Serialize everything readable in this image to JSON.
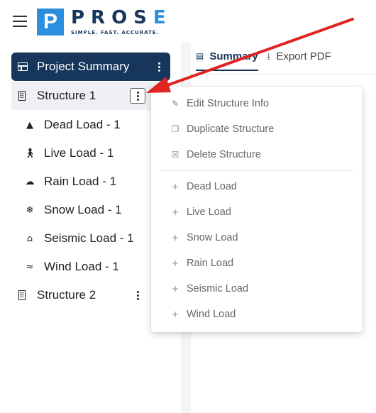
{
  "brand": {
    "logo_letter": "P",
    "name_main": "PROS",
    "name_accent": "E",
    "tagline": "SIMPLE. FAST. ACCURATE.",
    "colors": {
      "navy": "#16365c",
      "blue": "#2b8fe0",
      "arrow": "#e02424"
    }
  },
  "tabs": [
    {
      "label": "Summary",
      "icon": "document-icon",
      "active": true
    },
    {
      "label": "Export PDF",
      "icon": "download-icon",
      "active": false
    }
  ],
  "sidebar": {
    "project_summary": {
      "label": "Project Summary",
      "icon": "table-icon"
    },
    "structures": [
      {
        "label": "Structure 1",
        "icon": "building-icon",
        "selected": true,
        "loads": [
          {
            "label": "Dead Load - 1",
            "icon": "weight-icon"
          },
          {
            "label": "Live Load - 1",
            "icon": "person-walking-icon"
          },
          {
            "label": "Rain Load - 1",
            "icon": "cloud-rain-icon"
          },
          {
            "label": "Snow Load - 1",
            "icon": "snowflake-icon"
          },
          {
            "label": "Seismic Load - 1",
            "icon": "house-quake-icon"
          },
          {
            "label": "Wind Load - 1",
            "icon": "wind-icon"
          }
        ]
      },
      {
        "label": "Structure 2",
        "icon": "building-icon",
        "selected": false,
        "loads": []
      }
    ]
  },
  "context_menu": {
    "actions": [
      {
        "label": "Edit Structure Info",
        "icon": "edit-icon"
      },
      {
        "label": "Duplicate Structure",
        "icon": "copy-icon"
      },
      {
        "label": "Delete Structure",
        "icon": "trash-icon"
      }
    ],
    "add_items": [
      {
        "label": "Dead Load",
        "icon": "plus-icon"
      },
      {
        "label": "Live Load",
        "icon": "plus-icon"
      },
      {
        "label": "Snow Load",
        "icon": "plus-icon"
      },
      {
        "label": "Rain Load",
        "icon": "plus-icon"
      },
      {
        "label": "Seismic Load",
        "icon": "plus-icon"
      },
      {
        "label": "Wind Load",
        "icon": "plus-icon"
      }
    ]
  }
}
